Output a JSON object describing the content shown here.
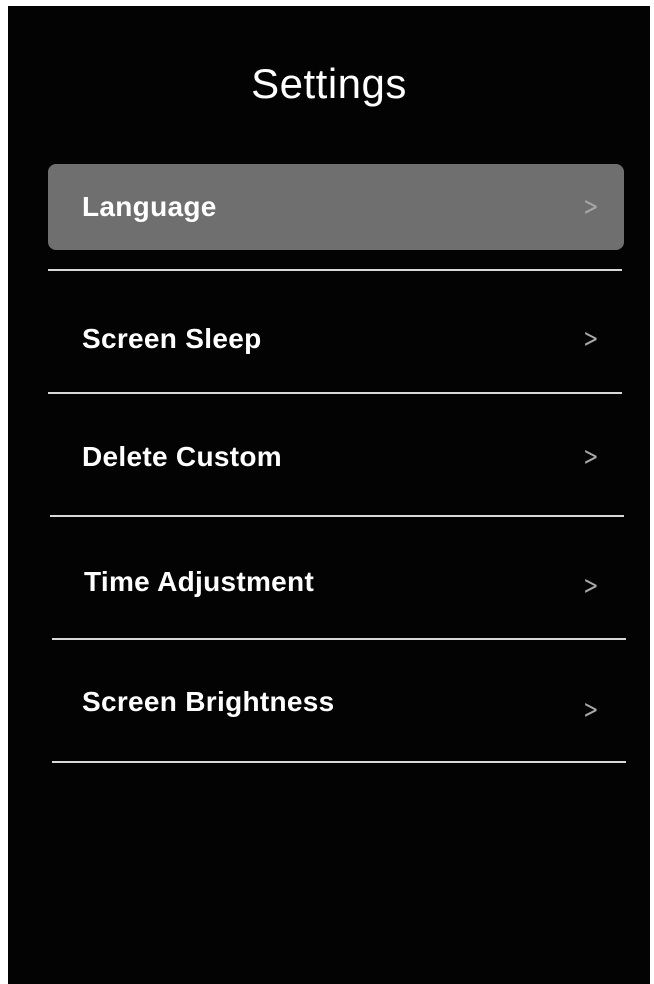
{
  "header": {
    "title": "Settings"
  },
  "menu": {
    "items": [
      {
        "label": "Language",
        "selected": true
      },
      {
        "label": "Screen Sleep",
        "selected": false
      },
      {
        "label": "Delete Custom",
        "selected": false
      },
      {
        "label": "Time Adjustment",
        "selected": false
      },
      {
        "label": "Screen Brightness",
        "selected": false
      }
    ],
    "chevron_glyph": ">"
  },
  "colors": {
    "background": "#030303",
    "selected_row": "#6f6f6f",
    "text": "#ffffff",
    "chevron": "#a8a8a8",
    "divider": "#d8d8d8"
  },
  "icons": {
    "chevron": "chevron-right-icon"
  }
}
